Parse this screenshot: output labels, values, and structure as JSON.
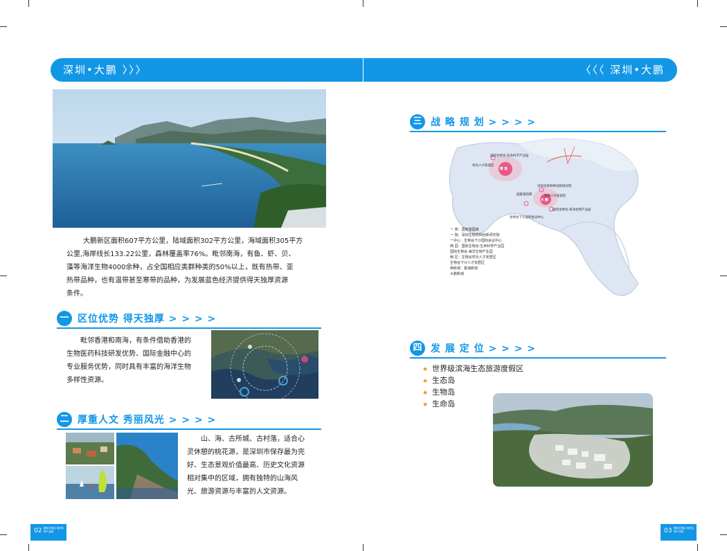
{
  "header": {
    "left_title": "深圳•大鹏  〉〉〉",
    "right_title": "〈〈〈 深圳•大鹏"
  },
  "intro": {
    "lines": [
      "大鹏新区面积607平方公里，陆域面积302平方公里，海域面积305平方",
      "公里,海岸线长133.22公里，森林覆盖率76%。毗邻南海，有鱼、虾、贝、",
      "藻等海洋生物4000余种，占全国相应类群种类的50%以上，既有热带、亚",
      "热带品种，也有温带甚至寒带的品种，为发展蓝色经济提供得天独厚资源",
      "条件。"
    ]
  },
  "section1": {
    "num": "一",
    "title": "区位优势 得天独厚 > > > >",
    "lines": [
      "毗邻香港和南海，有条件借助香港的",
      "生物医药科技研发优势、国际金融中心的",
      "专业服务优势，同时具有丰富的海洋生物",
      "多样性资源。"
    ]
  },
  "section2": {
    "num": "二",
    "title": "厚重人文 秀丽风光 > > > >",
    "lines": [
      "山、海、古所城、古村落，适合心",
      "灵休憩的桃花源，是深圳市保存最为完",
      "好、生态景观价值最高、历史文化资源",
      "相对集中的区域，拥有独特的山海风",
      "光、旅游资源与丰富的人文资源。"
    ]
  },
  "section3": {
    "num": "三",
    "title": "战 略 规 划  > > > >",
    "map_labels": {
      "biotech_park": "国际生物谷·生命科学产业园",
      "talent_zone": "坝光人才安居区",
      "bakuang": "葵 涌",
      "research": "深圳生物育种创新研究院",
      "talent_zone2": "生物人才安居区",
      "base": "国家基因库",
      "dapeng": "大 鹏",
      "marine_park": "国际生物谷·海洋生物产业园",
      "center": "生物谷下沙国际会议中心"
    },
    "legend": [
      "一  库：国家基因库",
      "一  院：深圳生物育种创新研究院",
      "一中心：生物谷下沙国际会议中心",
      "两  园：国际生物谷·生命科学产业园",
      "         国际生物谷·海洋生物产业园",
      "两  区：生物谷坝光人才安居区",
      "         生物谷下沙人才安居区",
      "两新城：葵涌新城",
      "         大鹏新城"
    ]
  },
  "section4": {
    "num": "四",
    "title": "发 展 定 位  > > > >",
    "bullets": [
      "世界级滨海生态旅游度假区",
      "生态岛",
      "生物岛",
      "生命岛"
    ],
    "star": "★"
  },
  "footer": {
    "left_page": "02",
    "right_page": "03",
    "label": "国际生物谷 海洋生物产业园"
  },
  "colors": {
    "accent": "#1296e6",
    "star": "#f08a1c"
  }
}
